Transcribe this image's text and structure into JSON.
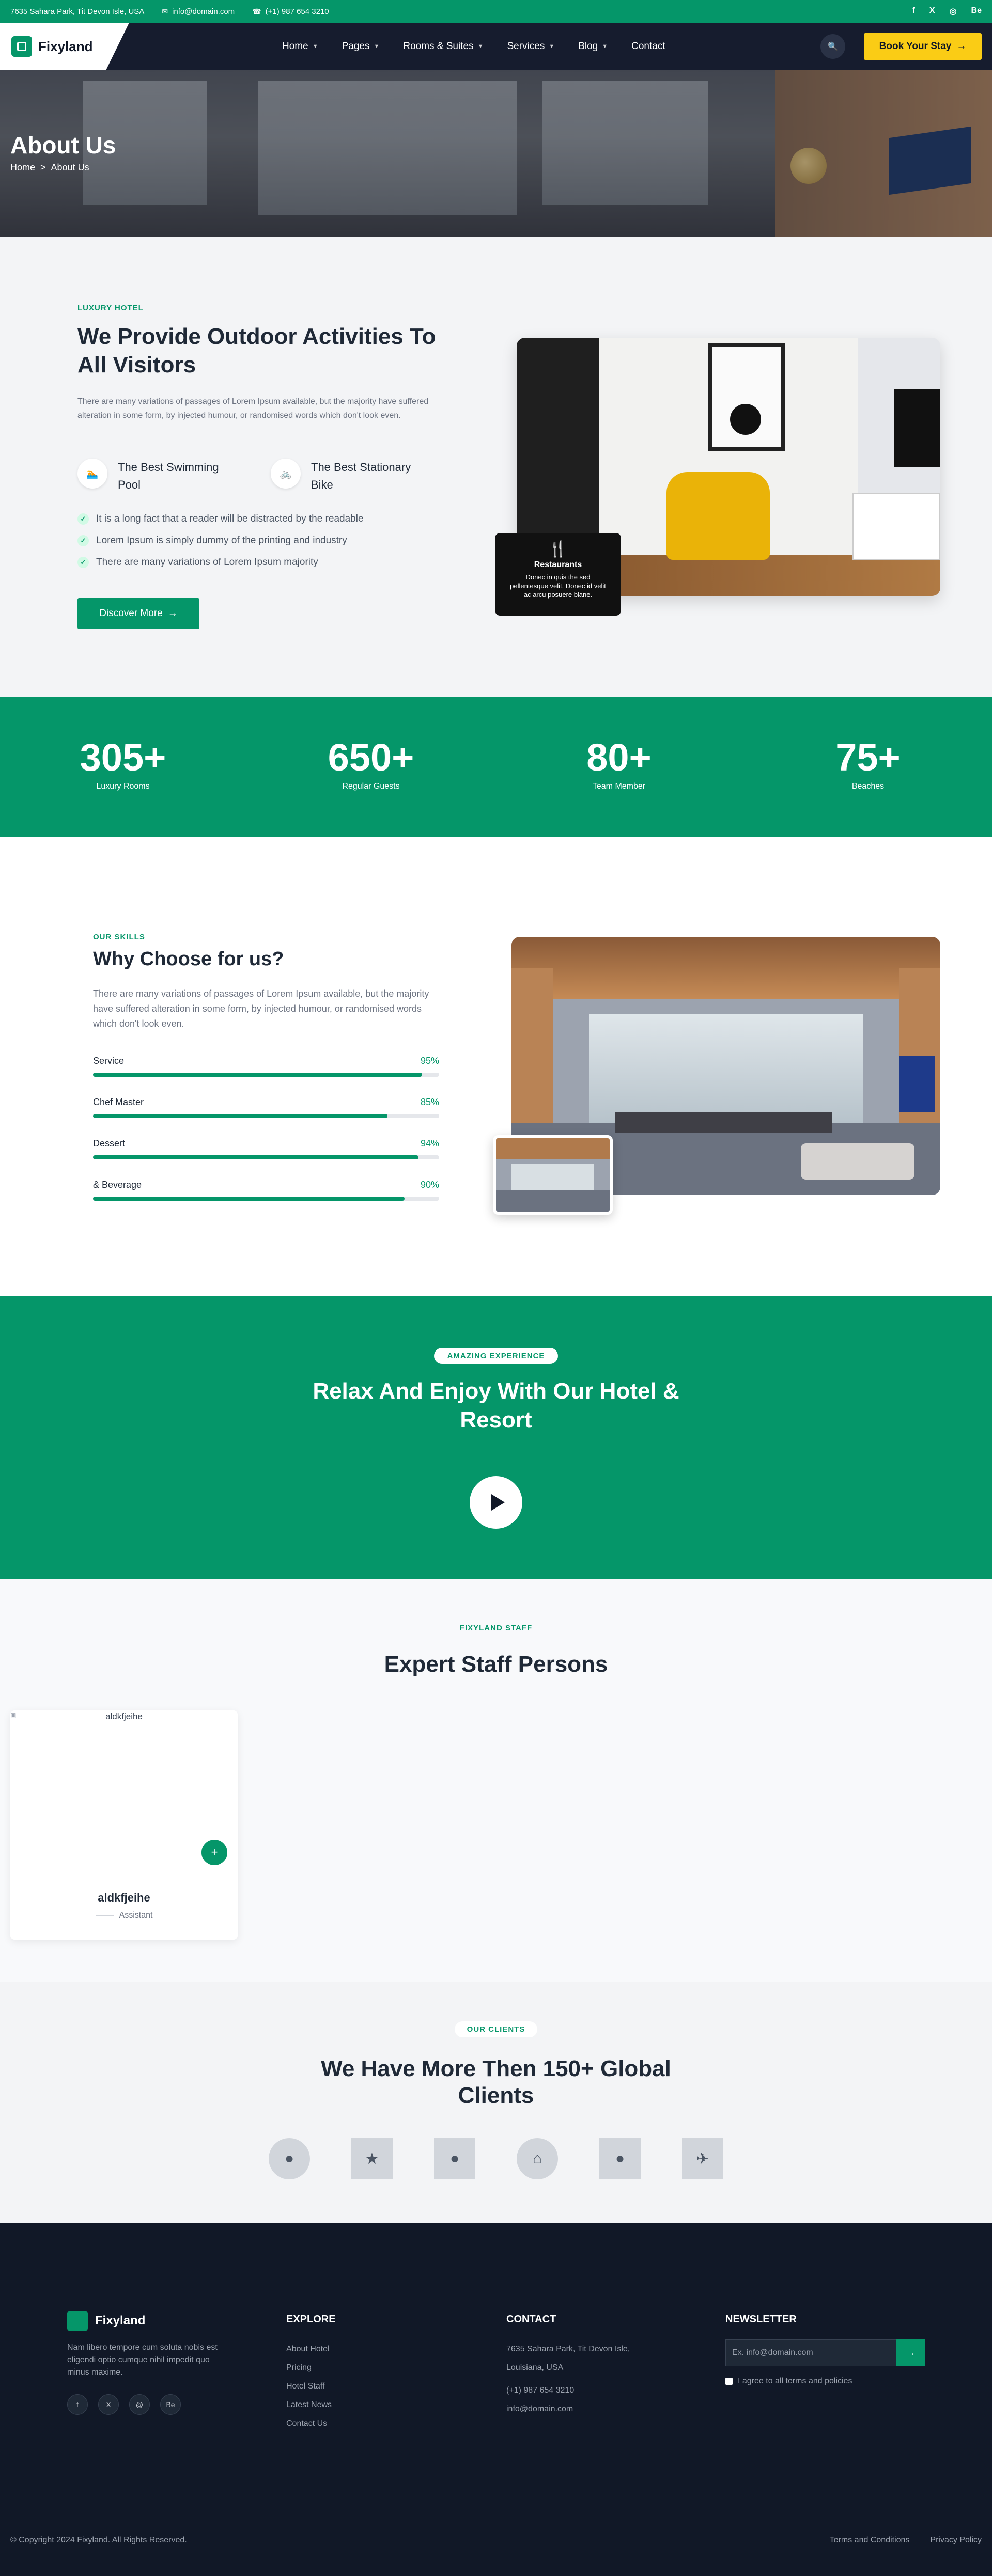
{
  "topbar": {
    "address": "7635 Sahara Park, Tit Devon Isle, USA",
    "email": "info@domain.com",
    "phone": "(+1) 987 654 3210",
    "social": [
      "f",
      "X",
      "◎",
      "Be"
    ]
  },
  "nav": {
    "logo": "Fixyland",
    "items": [
      "Home",
      "Pages",
      "Rooms & Suites",
      "Services",
      "Blog",
      "Contact"
    ],
    "book_label": "Book Your Stay",
    "arrow": "→"
  },
  "hero": {
    "title": "About Us",
    "crumb_home": "Home",
    "crumb_sep": ">",
    "crumb_current": "About Us"
  },
  "about": {
    "eyebrow": "LUXURY HOTEL",
    "title": "We Provide Outdoor Activities To All Visitors",
    "desc": "There are many variations of passages of Lorem Ipsum available, but the majority have suffered alteration in some form, by injected humour, or randomised words which don't look even.",
    "features": [
      "The Best Swimming Pool",
      "The Best Stationary Bike"
    ],
    "checks": [
      "It is a long fact that a reader will be distracted by the readable",
      "Lorem Ipsum is simply dummy of the printing and industry",
      "There are many variations of Lorem Ipsum majority"
    ],
    "button": "Discover More",
    "card_title": "Restaurants",
    "card_desc": "Donec in quis the sed pellentesque velit. Donec id velit ac arcu posuere blane."
  },
  "stats": [
    {
      "value": "305+",
      "label": "Luxury Rooms"
    },
    {
      "value": "650+",
      "label": "Regular Guests"
    },
    {
      "value": "80+",
      "label": "Team Member"
    },
    {
      "value": "75+",
      "label": "Beaches"
    }
  ],
  "skills": {
    "eyebrow": "OUR SKILLS",
    "title": "Why Choose for us?",
    "desc": "There are many variations of passages of Lorem Ipsum available, but the majority have suffered alteration in some form, by injected humour, or randomised words which don't look even.",
    "bars": [
      {
        "label": "Service",
        "value": 95,
        "text": "95%"
      },
      {
        "label": "Chef Master",
        "value": 85,
        "text": "85%"
      },
      {
        "label": "Dessert",
        "value": 94,
        "text": "94%"
      },
      {
        "label": "& Beverage",
        "value": 90,
        "text": "90%"
      }
    ]
  },
  "amazing": {
    "pill": "AMAZING EXPERIENCE",
    "title": "Relax And Enjoy With Our Hotel & Resort"
  },
  "staff": {
    "eyebrow": "FIXYLAND STAFF",
    "title": "Expert Staff Persons",
    "member": {
      "image_alt": "aldkfjeihe",
      "name": "aldkfjeihe",
      "role": "Assistant"
    }
  },
  "clients": {
    "pill": "OUR CLIENTS",
    "title": "We Have More Then 150+ Global Clients"
  },
  "footer": {
    "logo": "Fixyland",
    "desc": "Nam libero tempore cum soluta nobis est eligendi optio cumque nihil impedit quo minus maxime.",
    "social": [
      "f",
      "X",
      "@",
      "Be"
    ],
    "explore_title": "EXPLORE",
    "explore": [
      "About Hotel",
      "Pricing",
      "Hotel Staff",
      "Latest News",
      "Contact Us"
    ],
    "contact_title": "CONTACT",
    "contact": [
      "7635 Sahara Park, Tit Devon Isle,",
      "Louisiana, USA",
      "(+1) 987 654 3210",
      "info@domain.com"
    ],
    "newsletter_title": "NEWSLETTER",
    "newsletter_placeholder": "Ex. info@domain.com",
    "agree": "I agree to all terms and policies",
    "copyright": "© Copyright 2024 Fixyland. All Rights Reserved.",
    "links": [
      "Terms and Conditions",
      "Privacy Policy"
    ]
  },
  "colors": {
    "brand": "#059669",
    "accent": "#facc15",
    "dark": "#161c2e"
  }
}
